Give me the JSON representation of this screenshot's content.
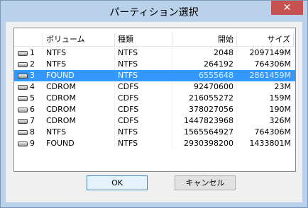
{
  "window": {
    "title": "パーティション選択",
    "close_glyph": "✕"
  },
  "table": {
    "headers": [
      "",
      "ボリューム",
      "種類",
      "開始",
      "サイズ"
    ],
    "selected_index": 2,
    "rows": [
      {
        "num": "1",
        "volume": "NTFS",
        "type": "NTFS",
        "start": "2048",
        "size": "2097149M"
      },
      {
        "num": "2",
        "volume": "NTFS",
        "type": "NTFS",
        "start": "264192",
        "size": "764306M"
      },
      {
        "num": "3",
        "volume": "FOUND",
        "type": "NTFS",
        "start": "6555648",
        "size": "2861459M"
      },
      {
        "num": "4",
        "volume": "CDROM",
        "type": "CDFS",
        "start": "92470600",
        "size": "23M"
      },
      {
        "num": "5",
        "volume": "CDROM",
        "type": "CDFS",
        "start": "216055272",
        "size": "159M"
      },
      {
        "num": "6",
        "volume": "CDROM",
        "type": "CDFS",
        "start": "378027056",
        "size": "190M"
      },
      {
        "num": "7",
        "volume": "CDROM",
        "type": "CDFS",
        "start": "1447823968",
        "size": "326M"
      },
      {
        "num": "8",
        "volume": "NTFS",
        "type": "NTFS",
        "start": "1565564927",
        "size": "764306M"
      },
      {
        "num": "9",
        "volume": "FOUND",
        "type": "NTFS",
        "start": "2930398200",
        "size": "1433801M"
      }
    ]
  },
  "buttons": {
    "ok": "OK",
    "cancel": "キャンセル"
  },
  "colors": {
    "selection": "#3399ff",
    "title_bar": "#b9d1ea",
    "close_button": "#c75050"
  }
}
